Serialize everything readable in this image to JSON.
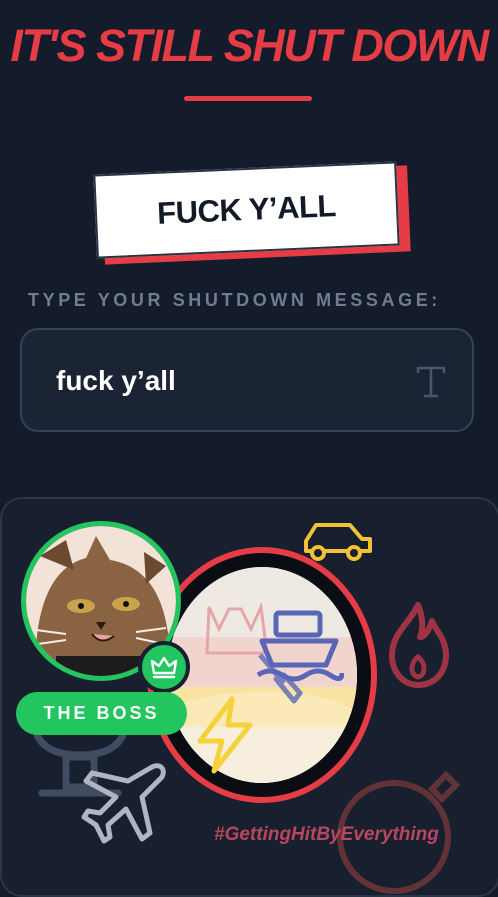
{
  "header": {
    "title": "IT'S STILL SHUT DOWN"
  },
  "sign": {
    "text": "FUCK Y’ALL"
  },
  "form": {
    "label": "TYPE YOUR SHUTDOWN MESSAGE:",
    "message_value": "fuck y’all",
    "text_icon": "text-format-icon"
  },
  "card": {
    "badge_label": "THE BOSS",
    "hashtag": "#GettingHitByEverything",
    "icons": [
      "car-icon",
      "fire-icon",
      "ship-icon",
      "lightning-icon",
      "airplane-icon",
      "bomb-icon",
      "crown-icon",
      "broom-icon"
    ]
  },
  "colors": {
    "background": "#141c2b",
    "accent_red": "#e63c45",
    "boss_green": "#22c55e",
    "label_gray": "#6f7c91",
    "input_border": "#344258"
  }
}
